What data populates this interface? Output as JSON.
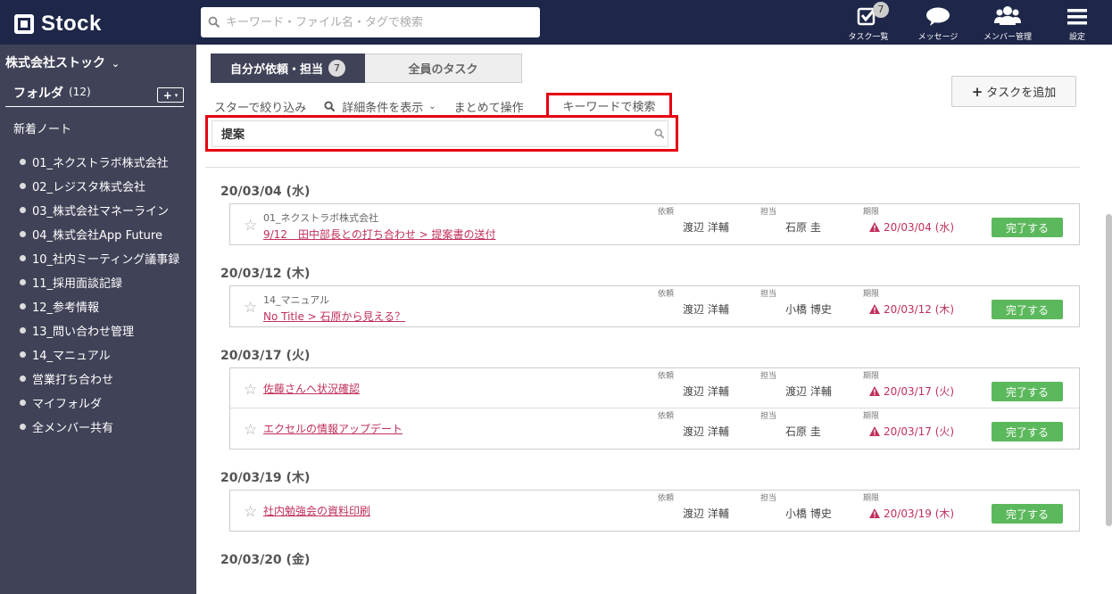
{
  "topbar": {
    "app_name": "Stock",
    "search_placeholder": "キーワード・ファイル名・タグで検索",
    "nav": [
      {
        "label": "タスク一覧",
        "icon": "task-list-icon",
        "badge": "7"
      },
      {
        "label": "メッセージ",
        "icon": "message-icon"
      },
      {
        "label": "メンバー管理",
        "icon": "members-icon"
      },
      {
        "label": "設定",
        "icon": "menu-icon"
      }
    ]
  },
  "sidebar": {
    "company": "株式会社ストック",
    "folder_title": "フォルダ",
    "folder_count": "(12)",
    "add_label": "+",
    "new_note": "新着ノート",
    "folders": [
      "01_ネクストラボ株式会社",
      "02_レジスタ株式会社",
      "03_株式会社マネーライン",
      "04_株式会社App Future",
      "10_社内ミーティング議事録",
      "11_採用面談記録",
      "12_参考情報",
      "13_問い合わせ管理",
      "14_マニュアル",
      "営業打ち合わせ",
      "マイフォルダ",
      "全メンバー共有"
    ]
  },
  "main": {
    "tab_mine": "自分が依頼・担当",
    "tab_mine_badge": "7",
    "tab_all": "全員のタスク",
    "filter_star": "スターで絞り込み",
    "filter_detail": "詳細条件を表示",
    "filter_bulk": "まとめて操作",
    "filter_keyword": "キーワードで検索",
    "keyword_value": "提案",
    "add_task": "タスクを追加",
    "label_requester": "依頼",
    "label_assignee": "担当",
    "label_deadline": "期限",
    "done_label": "完了する",
    "groups": [
      {
        "date": "20/03/04 (水)",
        "tasks": [
          {
            "folder": "01_ネクストラボ株式会社",
            "title": "9/12　田中部長との打ち合わせ > 提案書の送付",
            "requester": "渡辺 洋輔",
            "assignee": "石原 圭",
            "deadline": "20/03/04 (水)"
          }
        ]
      },
      {
        "date": "20/03/12 (木)",
        "tasks": [
          {
            "folder": "14_マニュアル",
            "title": "No Title > 石原から見える？",
            "requester": "渡辺 洋輔",
            "assignee": "小橋 博史",
            "deadline": "20/03/12 (木)"
          }
        ]
      },
      {
        "date": "20/03/17 (火)",
        "tasks": [
          {
            "folder": "",
            "title": "佐藤さんへ状況確認",
            "requester": "渡辺 洋輔",
            "assignee": "渡辺 洋輔",
            "deadline": "20/03/17 (火)"
          },
          {
            "folder": "",
            "title": "エクセルの情報アップデート",
            "requester": "渡辺 洋輔",
            "assignee": "石原 圭",
            "deadline": "20/03/17 (火)"
          }
        ]
      },
      {
        "date": "20/03/19 (木)",
        "tasks": [
          {
            "folder": "",
            "title": "社内勉強会の資料印刷",
            "requester": "渡辺 洋輔",
            "assignee": "小橋 博史",
            "deadline": "20/03/19 (木)"
          }
        ]
      },
      {
        "date": "20/03/20 (金)",
        "tasks": []
      }
    ]
  },
  "colors": {
    "topbar": "#1e2749",
    "sidebar": "#404257",
    "highlight": "#e60012",
    "done": "#5cb85c",
    "link": "#c0305a"
  }
}
